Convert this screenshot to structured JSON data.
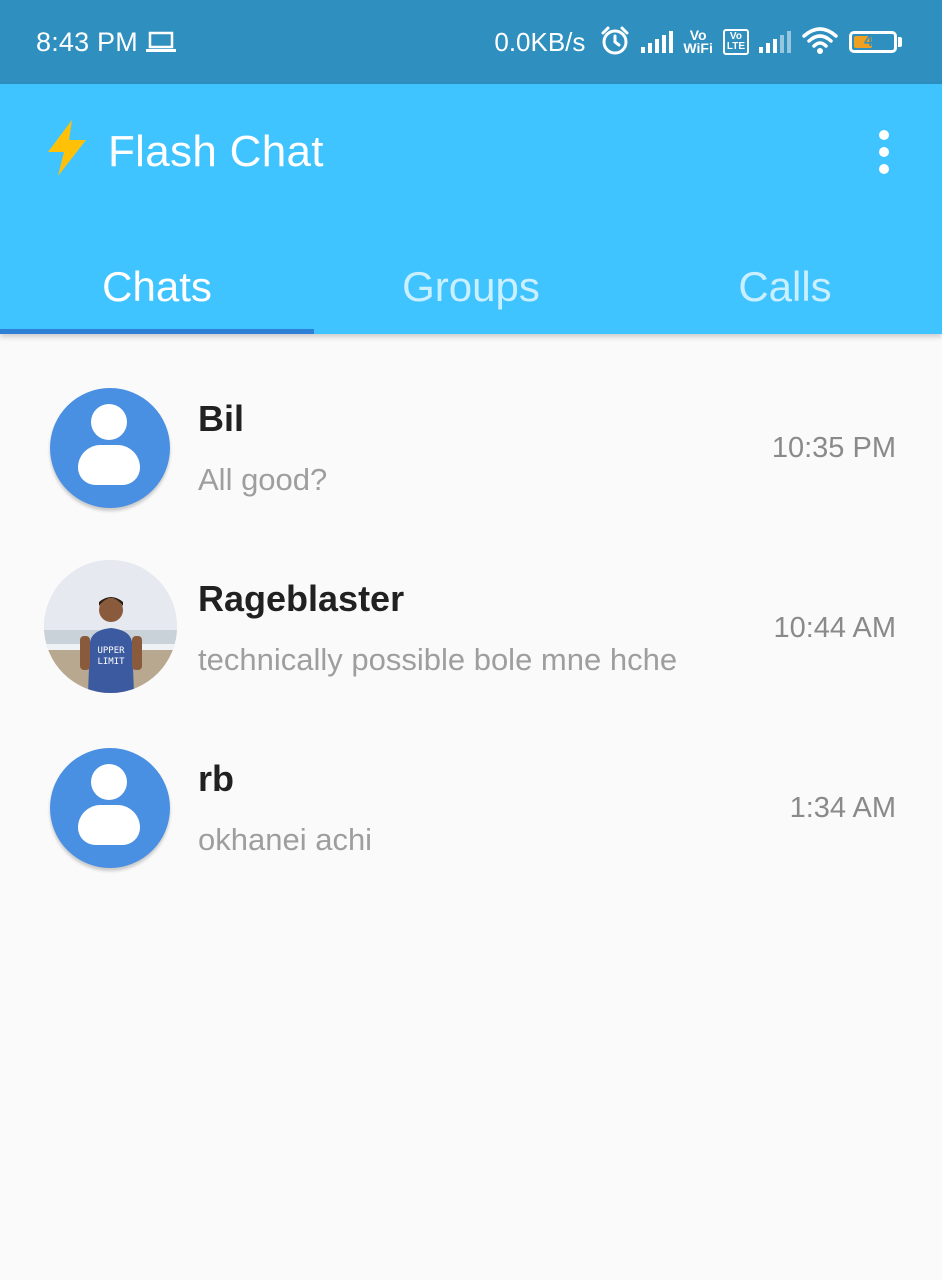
{
  "status_bar": {
    "time": "8:43 PM",
    "net_speed": "0.0KB/s",
    "vowifi_top": "Vo",
    "vowifi_bottom": "WiFi",
    "volte_top": "Vo",
    "volte_bottom": "LTE",
    "battery_level": "47",
    "battery_fraction": 0.47,
    "icons": [
      "laptop-icon",
      "alarm-icon",
      "signal-icon",
      "wifi-icon",
      "battery-icon"
    ]
  },
  "app_bar": {
    "icon": "lightning-bolt-icon",
    "title": "Flash Chat",
    "menu_icon": "more-vertical-icon"
  },
  "tabs": [
    {
      "label": "Chats",
      "active": true
    },
    {
      "label": "Groups",
      "active": false
    },
    {
      "label": "Calls",
      "active": false
    }
  ],
  "chats": [
    {
      "name": "Bil",
      "message": "All good?",
      "time": "10:35 PM",
      "avatar": "default-avatar-icon"
    },
    {
      "name": "Rageblaster",
      "message": "technically possible bole mne hche",
      "time": "10:44 AM",
      "avatar": "profile-photo",
      "shirt_text_1": "UPPER",
      "shirt_text_2": "LIMIT"
    },
    {
      "name": "rb",
      "message": "okhanei achi",
      "time": "1:34 AM",
      "avatar": "default-avatar-icon"
    }
  ],
  "colors": {
    "status_bar": "#2f8fbf",
    "app_bar": "#40c4ff",
    "tab_indicator": "#2e7fd6",
    "avatar": "#4a90e2",
    "bolt": "#ffc107"
  }
}
